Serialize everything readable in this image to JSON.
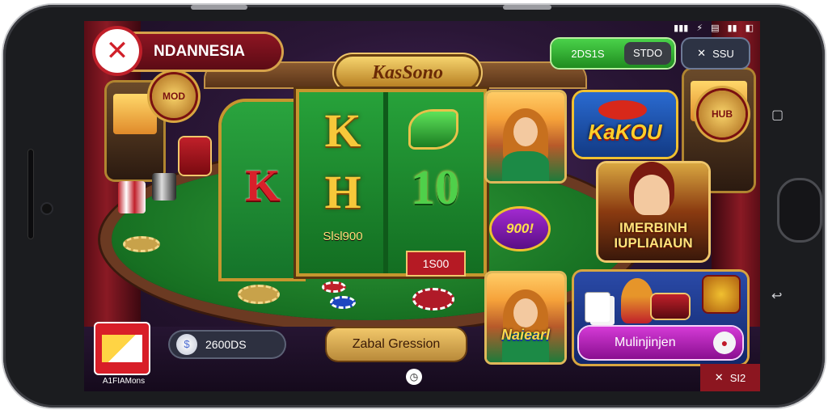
{
  "status_bar": {
    "icons": [
      "signal-icon",
      "wifi-icon",
      "battery-icon"
    ],
    "glyphs": [
      "▮▮▮",
      "⚡",
      "▤",
      "▮▮",
      "◧"
    ]
  },
  "region": {
    "label": "NDANNESIA",
    "close_glyph": "✕"
  },
  "top_right": {
    "green_left": "2DS1S",
    "green_right": "STDO",
    "dark_icon": "✕",
    "dark_label": "SSU"
  },
  "game_title": "KasSono",
  "reels": {
    "side_symbol": "K",
    "col1_symbols": [
      "K",
      "H"
    ],
    "col2_symbols": [
      "10"
    ],
    "col1_value": "Slsl900",
    "col2_value": "1S00",
    "promo_badge": "900!"
  },
  "right_panel": {
    "kabou_label": "KaKOU",
    "mid_promo": "IMERBINH\nIUPLIAIAUN",
    "lady_card_label": "Naiearl",
    "multi_button": "Mulinjinjen"
  },
  "emblems": {
    "left": "MOD",
    "right": "HUB"
  },
  "bottom": {
    "mail_label": "A1FIAMons",
    "coin_value": "2600DS",
    "gold_button": "Zabal Gression",
    "tools_label": "SI2",
    "tools_icon": "✕",
    "clock_glyph": "◷"
  },
  "phone_nav": {
    "recent": "▢",
    "back": "↩"
  },
  "colors": {
    "accent_green": "#1f8c1f",
    "accent_red": "#c0202a",
    "gold": "#d6a24a",
    "felt": "#177022"
  }
}
